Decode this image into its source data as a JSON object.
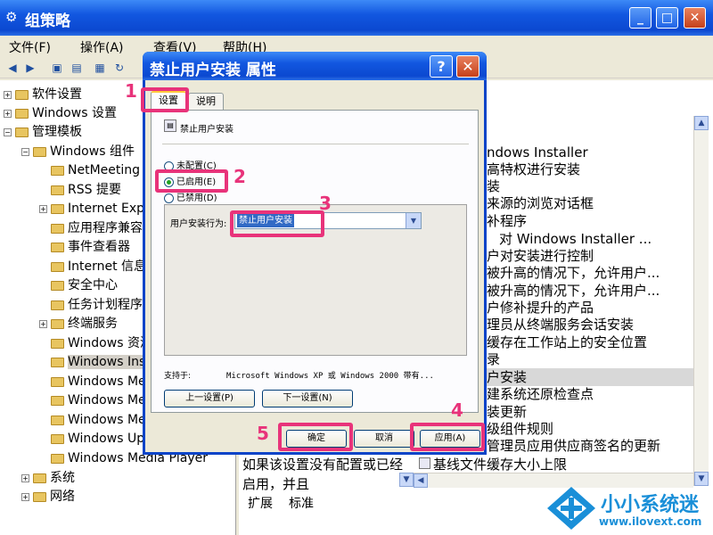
{
  "window": {
    "title": "组策略",
    "min": "_",
    "max": "□",
    "close": "✕"
  },
  "menu": [
    "文件(F)",
    "操作(A)",
    "查看(V)",
    "帮助(H)"
  ],
  "tree": [
    {
      "label": "软件设置",
      "expander": "+"
    },
    {
      "label": "Windows 设置",
      "expander": "+"
    },
    {
      "label": "管理模板",
      "expander": "−"
    },
    {
      "label": "Windows 组件",
      "expander": "−"
    },
    {
      "label": "NetMeeting",
      "expander": ""
    },
    {
      "label": "RSS 提要",
      "expander": ""
    },
    {
      "label": "Internet Explorer",
      "expander": "+"
    },
    {
      "label": "应用程序兼容性",
      "expander": ""
    },
    {
      "label": "事件查看器",
      "expander": ""
    },
    {
      "label": "Internet 信息服务",
      "expander": ""
    },
    {
      "label": "安全中心",
      "expander": ""
    },
    {
      "label": "任务计划程序",
      "expander": ""
    },
    {
      "label": "终端服务",
      "expander": "+"
    },
    {
      "label": "Windows 资源管理器",
      "expander": ""
    },
    {
      "label": "Windows Installer",
      "expander": ""
    },
    {
      "label": "Windows Messenger",
      "expander": ""
    },
    {
      "label": "Windows Media Digital Rights",
      "expander": ""
    },
    {
      "label": "Windows Media Center",
      "expander": ""
    },
    {
      "label": "Windows Update",
      "expander": ""
    },
    {
      "label": "Windows Media Player",
      "expander": ""
    },
    {
      "label": "系统",
      "expander": "+"
    },
    {
      "label": "网络",
      "expander": "+"
    }
  ],
  "right_pane": {
    "rows": [
      "ndows Installer",
      "高特权进行安装",
      "装",
      "来源的浏览对话框",
      "补程序",
      "对 Windows Installer ...",
      "户对安装进行控制",
      "被升高的情况下，允许用户...",
      "被升高的情况下，允许用户...",
      "户修补提升的产品",
      "理员从终端服务会话安装",
      "缓存在工作站上的安全位置",
      "录",
      "户安装",
      "建系统还原检查点",
      "装更新",
      "级组件规则",
      "管理员应用供应商签名的更新",
      "基线文件缓存大小上限"
    ],
    "description": "如果该设置没有配置或已经启用，并且",
    "tabs": [
      "扩展",
      "标准"
    ]
  },
  "dialog": {
    "title": "禁止用户安装 属性",
    "help": "?",
    "close": "✕",
    "tabs": [
      "设置",
      "说明"
    ],
    "policy_name": "禁止用户安装",
    "radios": [
      {
        "label": "未配置(C)",
        "checked": false
      },
      {
        "label": "已启用(E)",
        "checked": true
      },
      {
        "label": "已禁用(D)",
        "checked": false
      }
    ],
    "option_label": "用户安装行为:",
    "option_value": "禁止用户安装",
    "supported_label": "支持于:",
    "supported_value": "Microsoft Windows XP 或 Windows 2000 带有...",
    "prev_button": "上一设置(P)",
    "next_button": "下一设置(N)",
    "ok_button": "确定",
    "cancel_button": "取消",
    "apply_button": "应用(A)"
  },
  "annotations": [
    "1",
    "2",
    "3",
    "4",
    "5"
  ],
  "highlight_color": "#e8337a",
  "watermark": {
    "text": "小小系统迷",
    "url": "www.ilovext.com"
  }
}
